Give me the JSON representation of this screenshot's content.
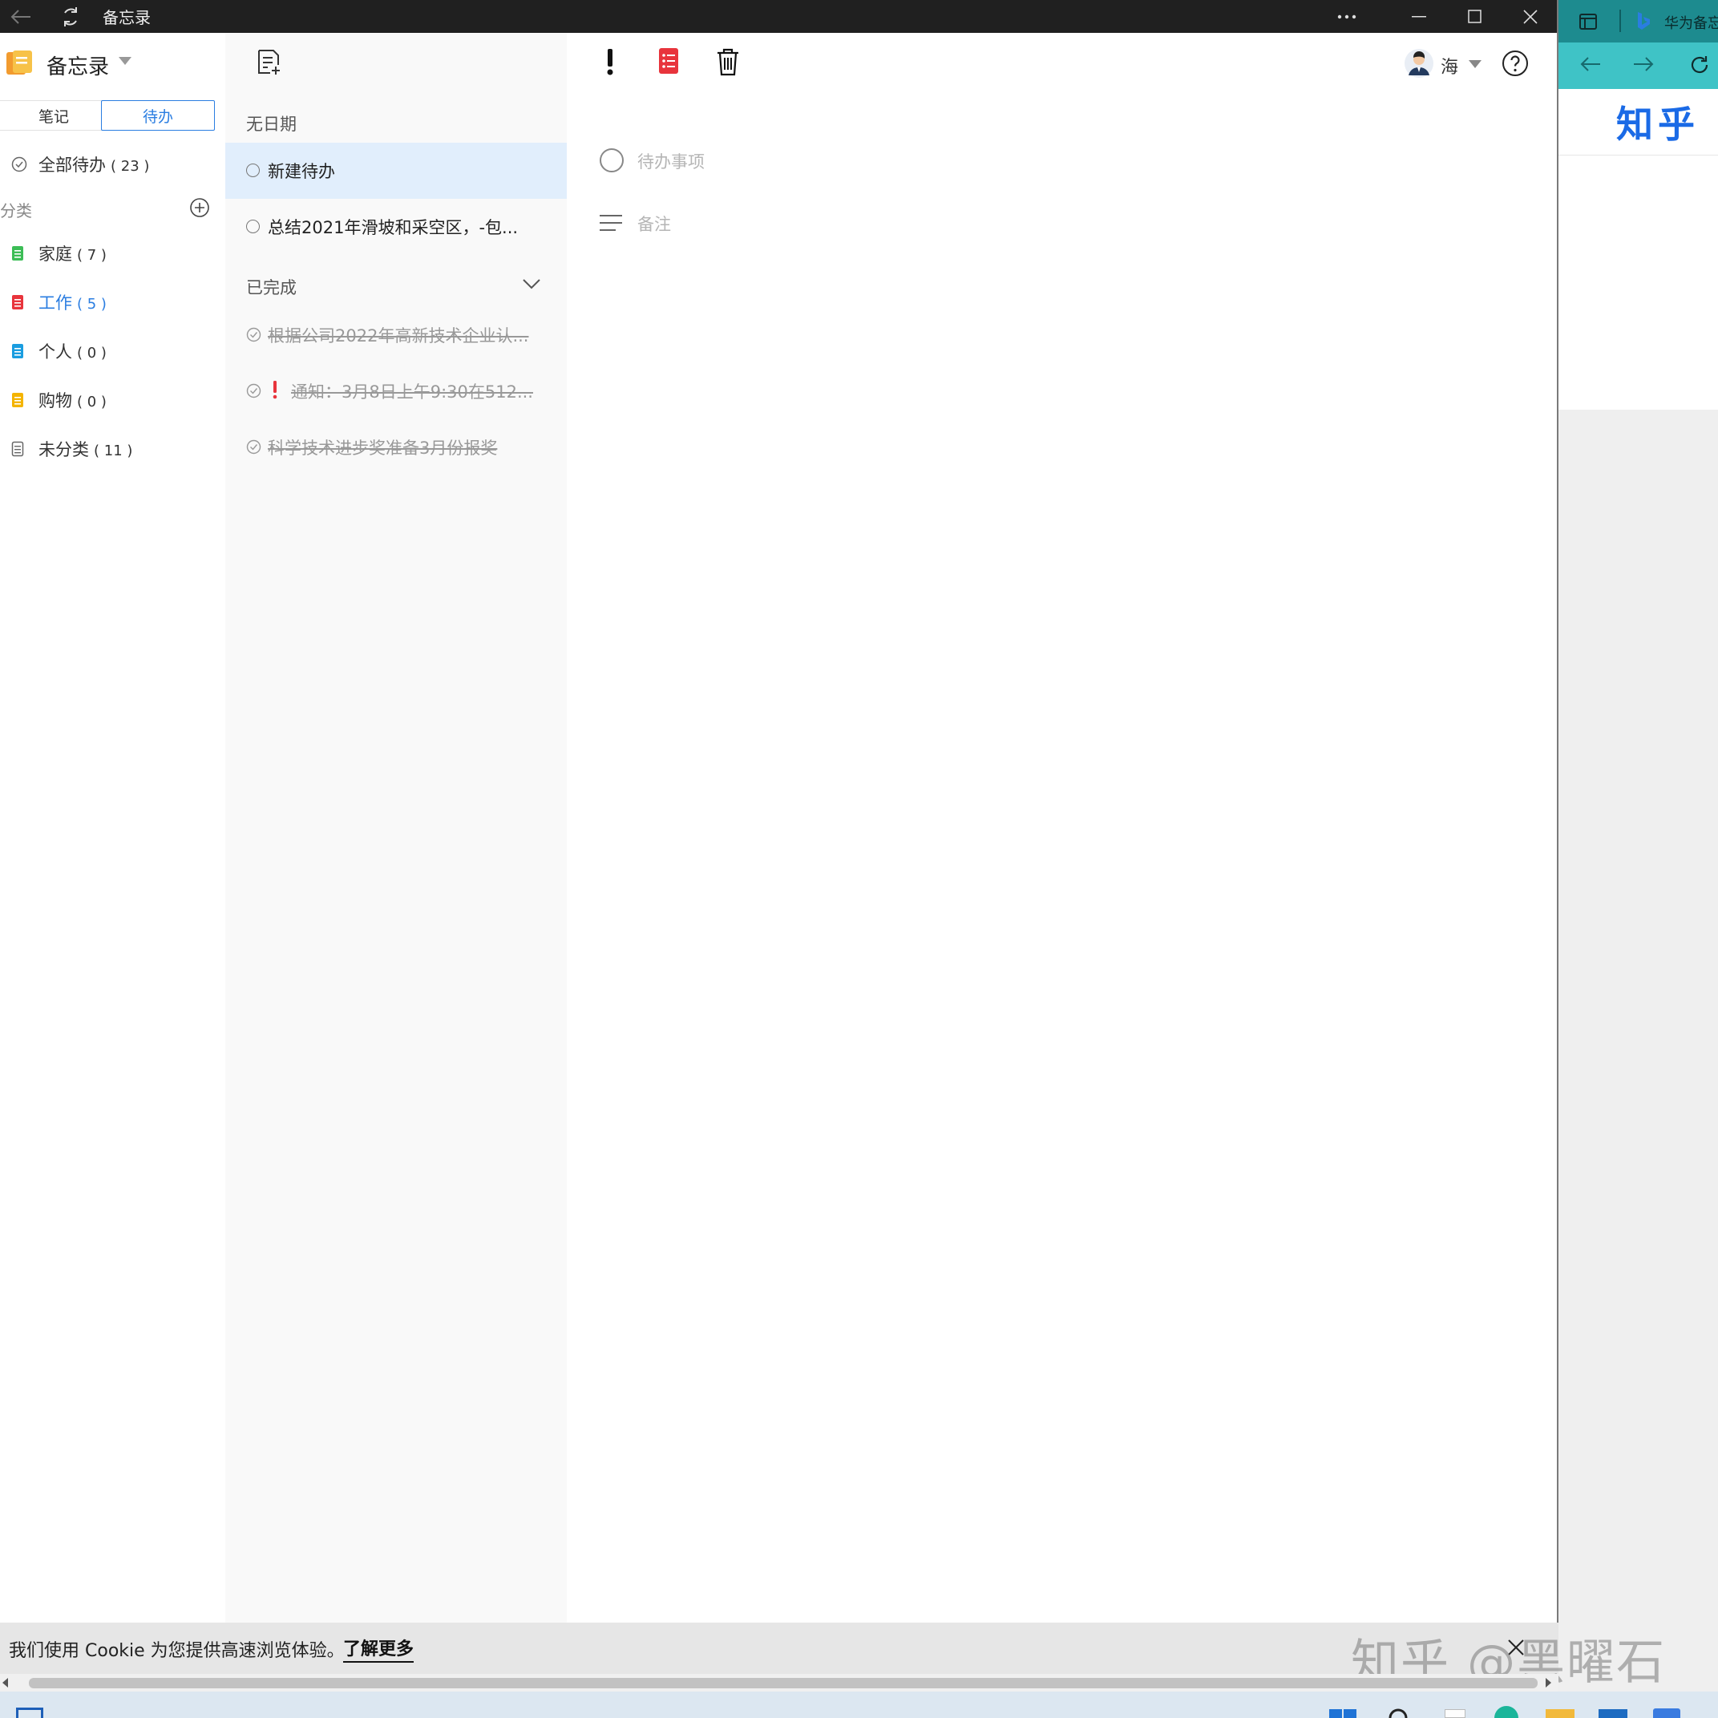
{
  "window": {
    "title": "备忘录",
    "more_icon": "more-horizontal-icon",
    "minimize_icon": "minimize-icon",
    "maximize_icon": "maximize-icon",
    "close_icon": "close-icon"
  },
  "sidebar": {
    "app_title": "备忘录",
    "tabs": {
      "notes": "笔记",
      "todo": "待办"
    },
    "all_todo": {
      "label": "全部待办",
      "count": "( 23 )"
    },
    "category_header": "分类",
    "categories": [
      {
        "label": "家庭",
        "count": "( 7 )",
        "color": "#3cbd56"
      },
      {
        "label": "工作",
        "count": "( 5 )",
        "color": "#e8343c"
      },
      {
        "label": "个人",
        "count": "( 0 )",
        "color": "#1a9de0"
      },
      {
        "label": "购物",
        "count": "( 0 )",
        "color": "#f4b400"
      },
      {
        "label": "未分类",
        "count": "( 11 )",
        "color": "#8a8a8a"
      }
    ]
  },
  "list": {
    "no_date_header": "无日期",
    "items": [
      {
        "text": "新建待办"
      },
      {
        "text": "总结2021年滑坡和采空区，-包..."
      }
    ],
    "completed_header": "已完成",
    "completed": [
      {
        "text": "根据公司2022年高新技术企业认...",
        "important": false
      },
      {
        "text": "通知：3月8日上午9:30在512...",
        "important": true
      },
      {
        "text": "科学技术进步奖准备3月份报奖",
        "important": false
      }
    ]
  },
  "editor": {
    "todo_placeholder": "待办事项",
    "note_placeholder": "备注",
    "user_name": "海"
  },
  "browser": {
    "tab_title": "华为备忘",
    "logo_text": "知乎"
  },
  "cookie": {
    "message": "我们使用 Cookie 为您提供高速浏览体验。",
    "learn_more": "了解更多"
  },
  "watermark": "知乎 @黑曜石",
  "colors": {
    "accent": "#2a7de1",
    "selected_row": "#e1eefc",
    "important": "#e8343c"
  }
}
